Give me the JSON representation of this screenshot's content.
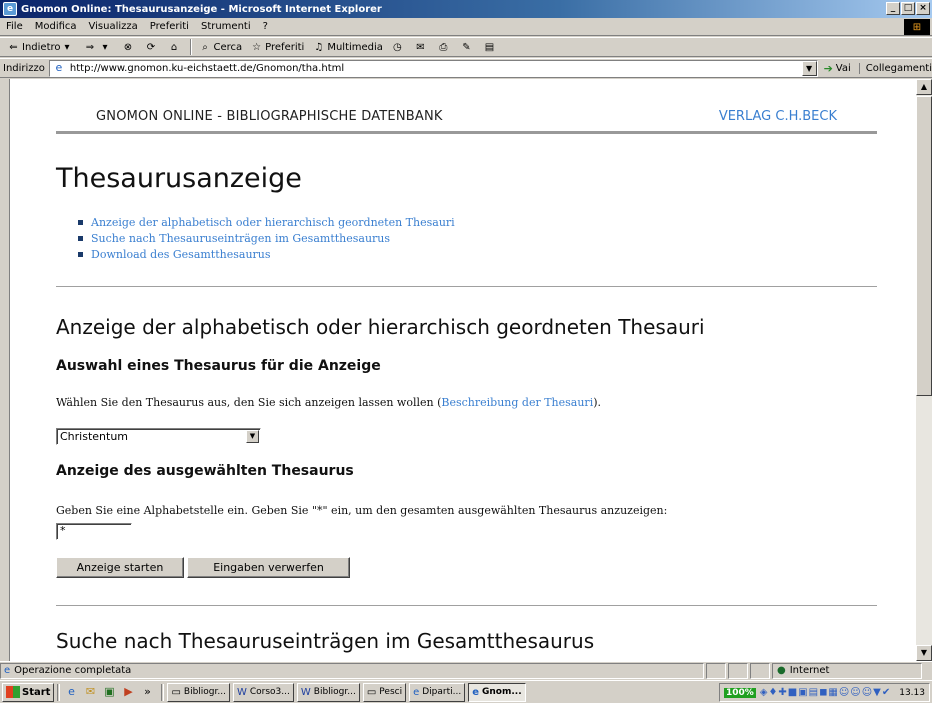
{
  "window": {
    "title": "Gnomon Online: Thesaurusanzeige - Microsoft Internet Explorer",
    "controls": [
      "_",
      "□",
      "×"
    ]
  },
  "menu": [
    "File",
    "Modifica",
    "Visualizza",
    "Preferiti",
    "Strumenti",
    "?"
  ],
  "toolbar": {
    "back": "Indietro",
    "search": "Cerca",
    "favorites": "Preferiti",
    "media": "Multimedia"
  },
  "address": {
    "label": "Indirizzo",
    "url": "http://www.gnomon.ku-eichstaett.de/Gnomon/tha.html",
    "go": "Vai",
    "links": "Collegamenti"
  },
  "page": {
    "site_name": "GNOMON ONLINE - BIBLIOGRAPHISCHE DATENBANK",
    "publisher": "VERLAG C.H.BECK",
    "title": "Thesaurusanzeige",
    "toc": [
      "Anzeige der alphabetisch oder hierarchisch geordneten Thesauri",
      "Suche nach Thesauruseinträgen im Gesamtthesaurus",
      "Download des Gesamtthesaurus"
    ],
    "section1": {
      "heading": "Anzeige der alphabetisch oder hierarchisch geordneten Thesauri",
      "sub1": "Auswahl eines Thesaurus für die Anzeige",
      "sub1_text": "Wählen Sie den Thesaurus aus, den Sie sich anzeigen lassen wollen (",
      "sub1_link": "Beschreibung der Thesauri",
      "sub1_text_end": ").",
      "select_value": "Christentum",
      "sub2": "Anzeige des ausgewählten Thesaurus",
      "sub2_text": "Geben Sie eine Alphabetstelle ein. Geben Sie \"*\" ein, um den gesamten ausgewählten Thesaurus anzuzeigen:",
      "input_value": "*",
      "btn_start": "Anzeige starten",
      "btn_reset": "Eingaben verwerfen"
    },
    "section2": {
      "heading": "Suche nach Thesauruseinträgen im Gesamtthesaurus"
    }
  },
  "status": {
    "text": "Operazione completata",
    "zone": "Internet"
  },
  "taskbar": {
    "start": "Start",
    "tasks": [
      "Bibliogr...",
      "Corso3...",
      "Bibliogr...",
      "Pesci",
      "Diparti...",
      "Gnom..."
    ],
    "tray_badge": "100%",
    "clock": "13.13"
  }
}
